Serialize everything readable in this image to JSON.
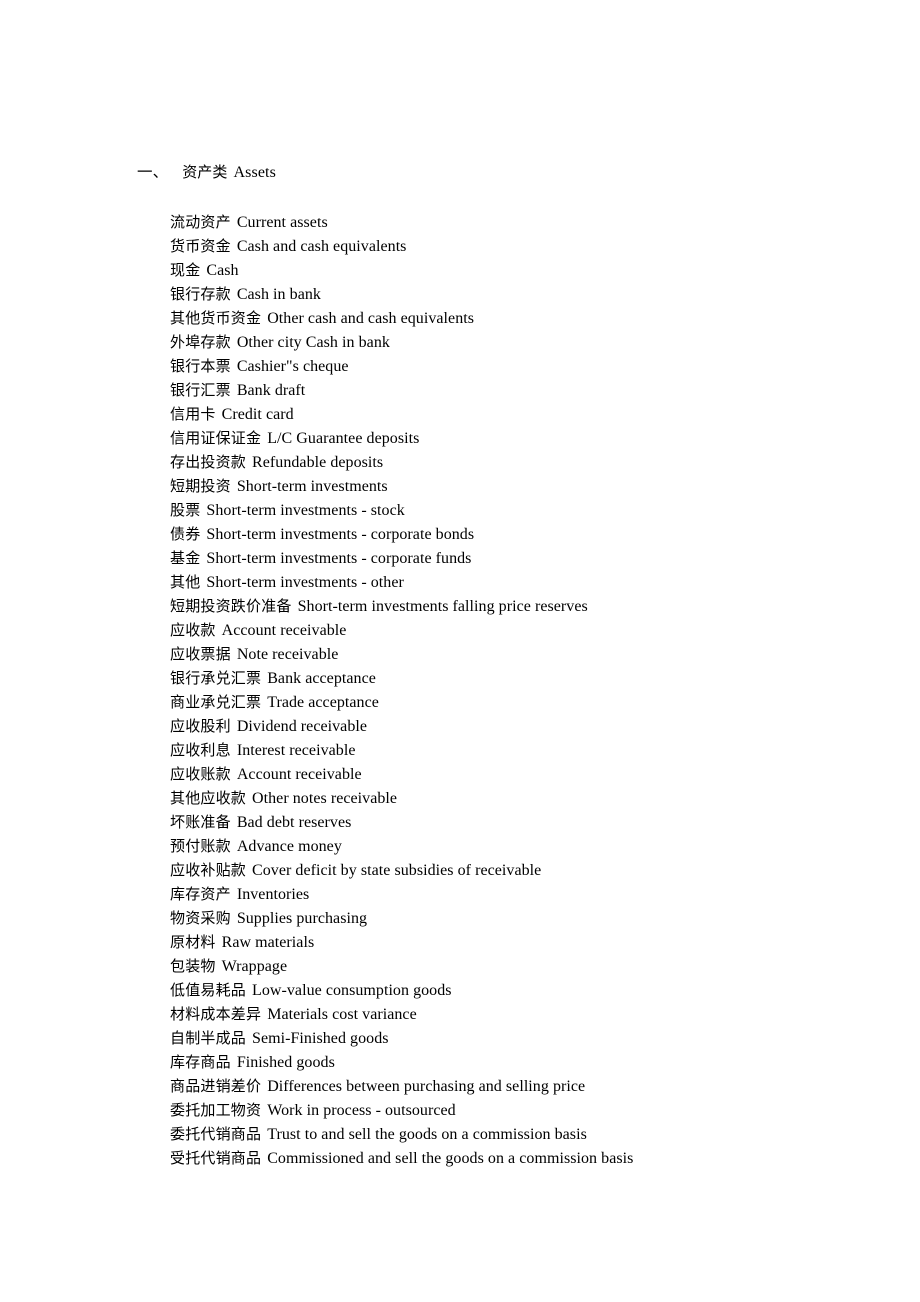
{
  "document": {
    "heading": {
      "ordinal": "一、",
      "cn": "资产类",
      "en": "Assets"
    },
    "terms": [
      {
        "cn": "流动资产",
        "en": "Current assets"
      },
      {
        "cn": "货币资金",
        "en": "Cash and cash equivalents"
      },
      {
        "cn": "现金",
        "en": "Cash"
      },
      {
        "cn": "银行存款",
        "en": "Cash in bank"
      },
      {
        "cn": "其他货币资金",
        "en": "Other cash and cash equivalents"
      },
      {
        "cn": "外埠存款",
        "en": "Other city Cash in bank"
      },
      {
        "cn": "银行本票",
        "en": "Cashier\"s cheque"
      },
      {
        "cn": "银行汇票",
        "en": "Bank draft"
      },
      {
        "cn": "信用卡",
        "en": "Credit card"
      },
      {
        "cn": "信用证保证金",
        "en": "L/C Guarantee deposits"
      },
      {
        "cn": "存出投资款",
        "en": "Refundable deposits"
      },
      {
        "cn": "短期投资",
        "en": "Short-term investments"
      },
      {
        "cn": "股票",
        "en": "Short-term investments - stock"
      },
      {
        "cn": "债券",
        "en": "Short-term investments - corporate bonds"
      },
      {
        "cn": "基金",
        "en": "Short-term investments - corporate funds"
      },
      {
        "cn": "其他",
        "en": "Short-term investments - other"
      },
      {
        "cn": "短期投资跌价准备",
        "en": "Short-term investments falling price reserves"
      },
      {
        "cn": "应收款",
        "en": "Account receivable"
      },
      {
        "cn": "应收票据",
        "en": "Note receivable"
      },
      {
        "cn": "银行承兑汇票",
        "en": "Bank acceptance"
      },
      {
        "cn": "商业承兑汇票",
        "en": "Trade acceptance"
      },
      {
        "cn": "应收股利",
        "en": "Dividend receivable"
      },
      {
        "cn": "应收利息",
        "en": "Interest receivable"
      },
      {
        "cn": "应收账款",
        "en": "Account receivable"
      },
      {
        "cn": "其他应收款",
        "en": "Other notes receivable"
      },
      {
        "cn": "坏账准备",
        "en": "Bad debt reserves"
      },
      {
        "cn": "预付账款",
        "en": "Advance money"
      },
      {
        "cn": "应收补贴款",
        "en": "Cover deficit by state subsidies of receivable"
      },
      {
        "cn": "库存资产",
        "en": "Inventories"
      },
      {
        "cn": "物资采购",
        "en": "Supplies purchasing"
      },
      {
        "cn": "原材料",
        "en": "Raw materials"
      },
      {
        "cn": "包装物",
        "en": "Wrappage"
      },
      {
        "cn": "低值易耗品",
        "en": "Low-value consumption goods"
      },
      {
        "cn": "材料成本差异",
        "en": "Materials cost variance"
      },
      {
        "cn": "自制半成品",
        "en": "Semi-Finished goods"
      },
      {
        "cn": "库存商品",
        "en": "Finished goods"
      },
      {
        "cn": "商品进销差价",
        "en": "Differences between purchasing and selling price"
      },
      {
        "cn": "委托加工物资",
        "en": "Work in process - outsourced"
      },
      {
        "cn": "委托代销商品",
        "en": "Trust to and sell the goods on a commission basis"
      },
      {
        "cn": "受托代销商品",
        "en": "Commissioned and sell the goods on a commission basis"
      }
    ]
  },
  "style": {
    "text_color": "#000000",
    "background_color": "#ffffff"
  }
}
